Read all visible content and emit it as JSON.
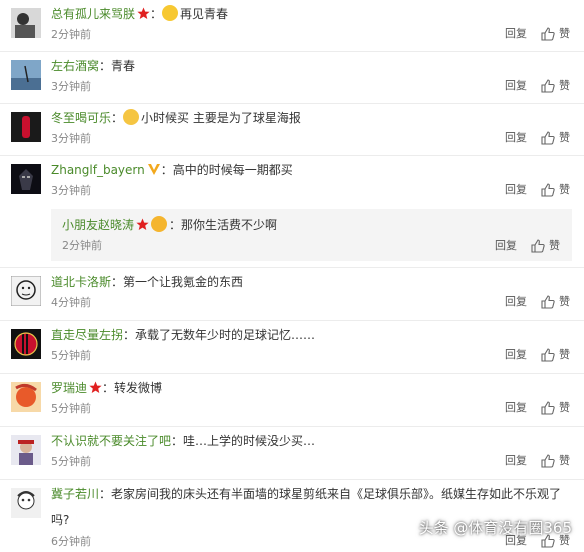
{
  "actions": {
    "reply": "回复",
    "like": "赞"
  },
  "comments": [
    {
      "user": "总有孤儿来骂朕",
      "sep": "：",
      "text": "再见青春",
      "time": "2分钟前"
    },
    {
      "user": "左右酒窝",
      "sep": "：",
      "text": "青春",
      "time": "3分钟前"
    },
    {
      "user": "冬至喝可乐",
      "sep": "：",
      "text": "小时候买 主要是为了球星海报",
      "time": "3分钟前"
    },
    {
      "user": "Zhanglf_bayern",
      "sep": "：",
      "text": "高中的时候每一期都买",
      "time": "3分钟前"
    },
    {
      "user": "小朋友赵晓涛",
      "sep": "：",
      "text": "那你生活费不少啊",
      "time": "2分钟前"
    },
    {
      "user": "道北卡洛斯",
      "sep": "：",
      "text": "第一个让我氪金的东西",
      "time": "4分钟前"
    },
    {
      "user": "直走尽量左拐",
      "sep": "：",
      "text": "承载了无数年少时的足球记忆……",
      "time": "5分钟前"
    },
    {
      "user": "罗瑞迪",
      "sep": "：",
      "text": "转发微博",
      "time": "5分钟前"
    },
    {
      "user": "不认识就不要关注了吧",
      "sep": "：",
      "text": "哇…上学的时候没少买…",
      "time": "5分钟前"
    },
    {
      "user": "冀子若川",
      "sep": "：",
      "text": "老家房间我的床头还有半面墙的球星剪纸来自《足球俱乐部》。纸媒生存如此不乐观了",
      "text2": "吗?",
      "time": "6分钟前"
    }
  ],
  "watermark": "头条 @体育没有圈365"
}
